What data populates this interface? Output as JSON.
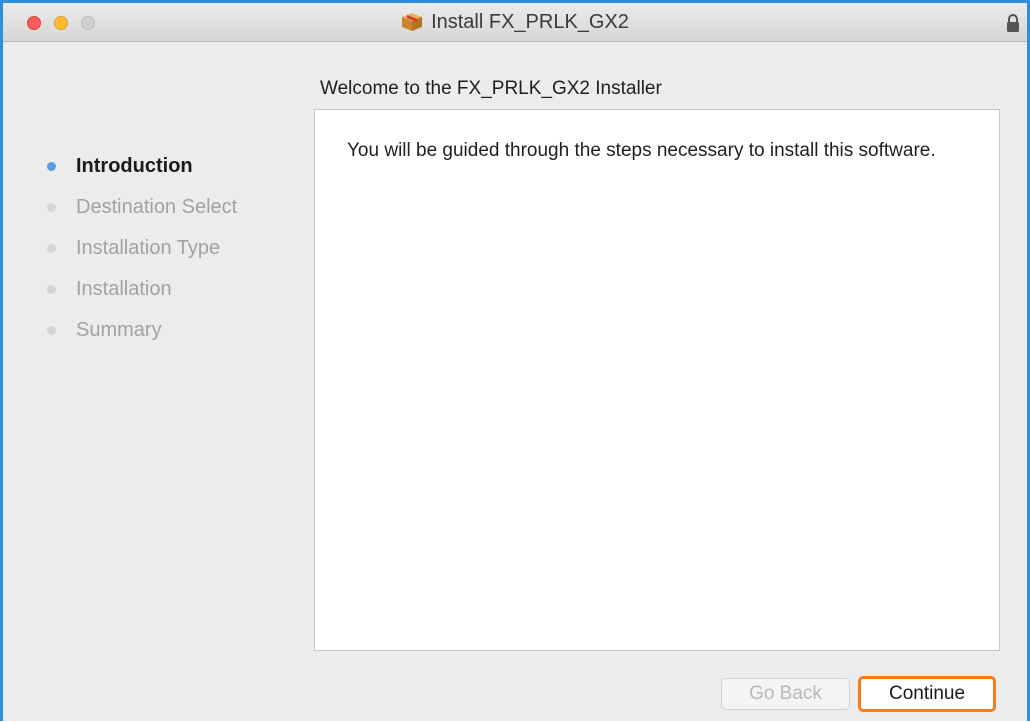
{
  "window": {
    "title": "Install FX_PRLK_GX2",
    "icons": {
      "title": "package-icon",
      "lock": "lock-icon"
    }
  },
  "main": {
    "heading": "Welcome to the FX_PRLK_GX2 Installer",
    "body_text": "You will be guided through the steps necessary to install this software."
  },
  "steps": [
    {
      "label": "Introduction",
      "active": true
    },
    {
      "label": "Destination Select",
      "active": false
    },
    {
      "label": "Installation Type",
      "active": false
    },
    {
      "label": "Installation",
      "active": false
    },
    {
      "label": "Summary",
      "active": false
    }
  ],
  "buttons": {
    "go_back": "Go Back",
    "continue": "Continue"
  },
  "colors": {
    "frame_highlight": "#2f8fdc",
    "active_step_dot": "#5a9ce6",
    "continue_highlight": "#f57c1f"
  }
}
